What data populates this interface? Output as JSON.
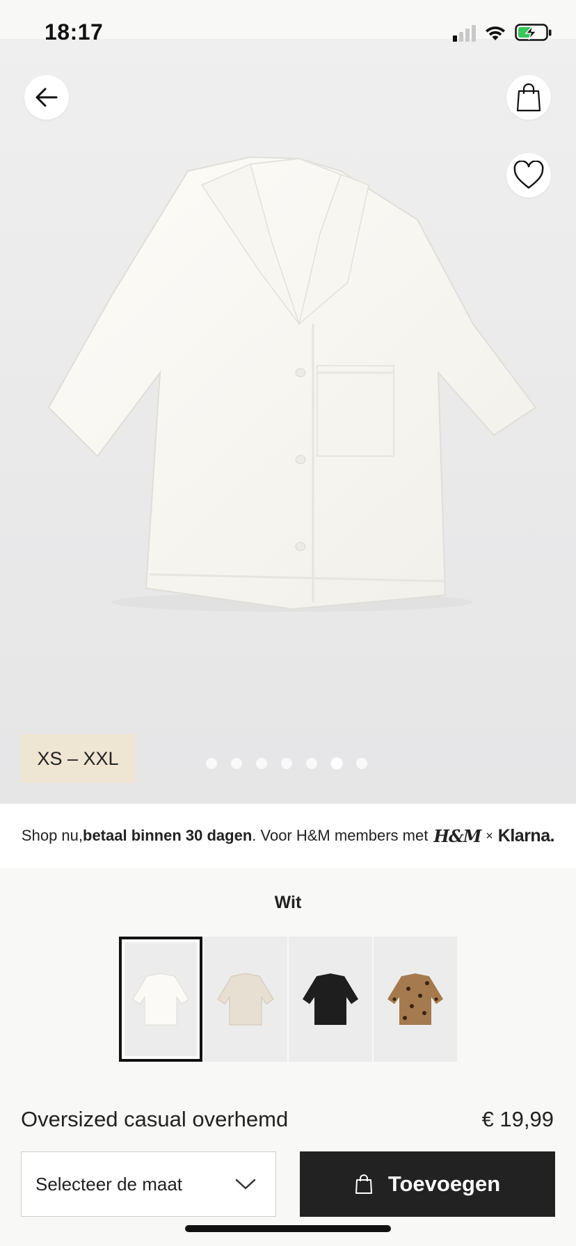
{
  "status_bar": {
    "time": "18:17"
  },
  "hero": {
    "size_range": "XS – XXL",
    "carousel_total": 7,
    "carousel_active_index": 5,
    "icons": {
      "back": "arrow-left-icon",
      "bag": "shopping-bag-icon",
      "favorite": "heart-icon"
    }
  },
  "promo": {
    "lead": "Shop nu, ",
    "bold": "betaal binnen 30 dagen",
    "tail": ". Voor H&M members met",
    "brand_hm": "H&M",
    "times": "×",
    "brand_klarna": "Klarna."
  },
  "color_selector": {
    "selected_name": "Wit",
    "swatches": [
      {
        "name": "Wit",
        "color": "#fbfaf6"
      },
      {
        "name": "Beige",
        "color": "#e7dfd1"
      },
      {
        "name": "Zwart",
        "color": "#1e1e1e"
      },
      {
        "name": "Luipaardprint",
        "color": "#a57a4e"
      }
    ]
  },
  "product": {
    "name": "Oversized casual overhemd",
    "price": "€ 19,99"
  },
  "actions": {
    "size_select_label": "Selecteer de maat",
    "add_label": "Toevoegen"
  },
  "colors": {
    "primary_button": "#222222",
    "size_badge": "#efe5d3"
  }
}
